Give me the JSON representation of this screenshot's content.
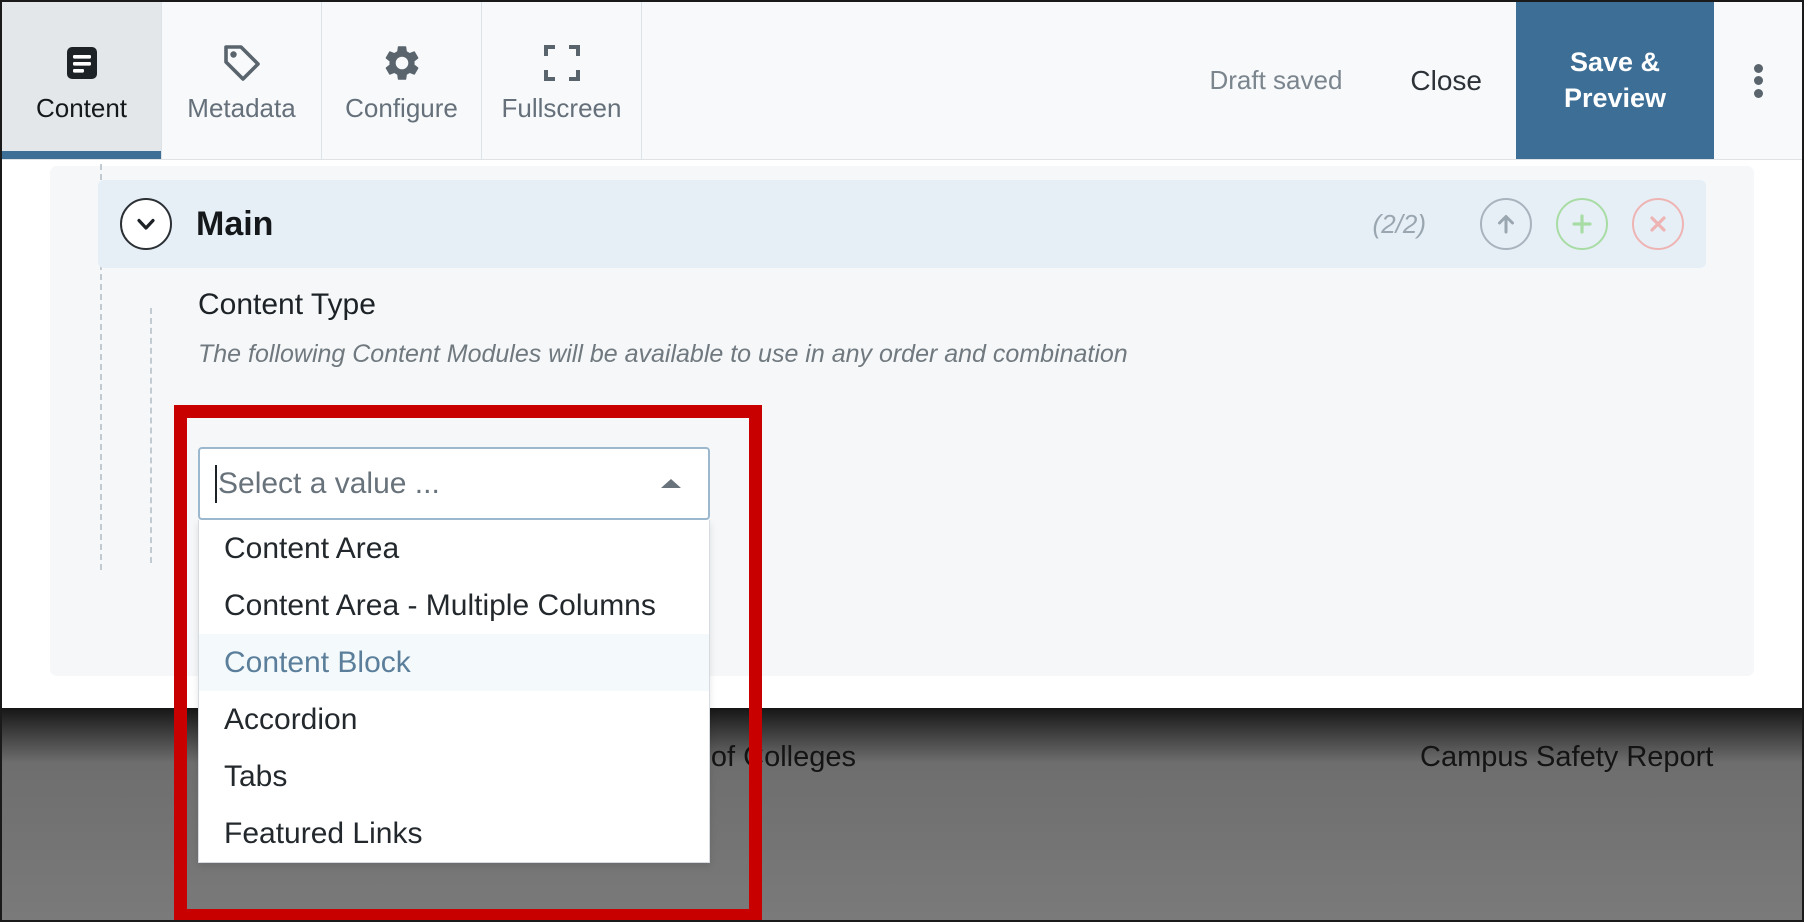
{
  "toolbar": {
    "tabs": [
      {
        "label": "Content",
        "icon": "document-lines-icon",
        "active": true
      },
      {
        "label": "Metadata",
        "icon": "tag-icon",
        "active": false
      },
      {
        "label": "Configure",
        "icon": "gear-icon",
        "active": false
      },
      {
        "label": "Fullscreen",
        "icon": "expand-icon",
        "active": false
      }
    ],
    "draft_status": "Draft saved",
    "close_label": "Close",
    "save_preview_line1": "Save &",
    "save_preview_line2": "Preview",
    "overflow_icon": "kebab-menu-icon",
    "accent_color": "#3c6e96"
  },
  "section": {
    "title": "Main",
    "counter": "(2/2)",
    "collapse_icon": "chevron-down-icon",
    "move_up_icon": "arrow-up-icon",
    "add_icon": "plus-icon",
    "remove_icon": "close-circle-icon",
    "header_bg": "#e7eff6",
    "add_color": "#a8dca5",
    "remove_color": "#eeb4b4"
  },
  "field": {
    "label": "Content Type",
    "help_text": "The following Content Modules will be available to use in any order and combination",
    "placeholder": "Select a value ...",
    "value": "",
    "arrow_icon": "caret-up-icon",
    "options": [
      {
        "label": "Content Area",
        "highlighted": false
      },
      {
        "label": "Content Area - Multiple Columns",
        "highlighted": false
      },
      {
        "label": "Content Block",
        "highlighted": true
      },
      {
        "label": "Accordion",
        "highlighted": false
      },
      {
        "label": "Tabs",
        "highlighted": false
      },
      {
        "label": "Featured Links",
        "highlighted": false
      }
    ]
  },
  "annotation": {
    "color": "#c80000",
    "shape": "rectangle-outline"
  },
  "footer": {
    "links": [
      "wbook of Colleges",
      "Campus Safety Report"
    ]
  }
}
